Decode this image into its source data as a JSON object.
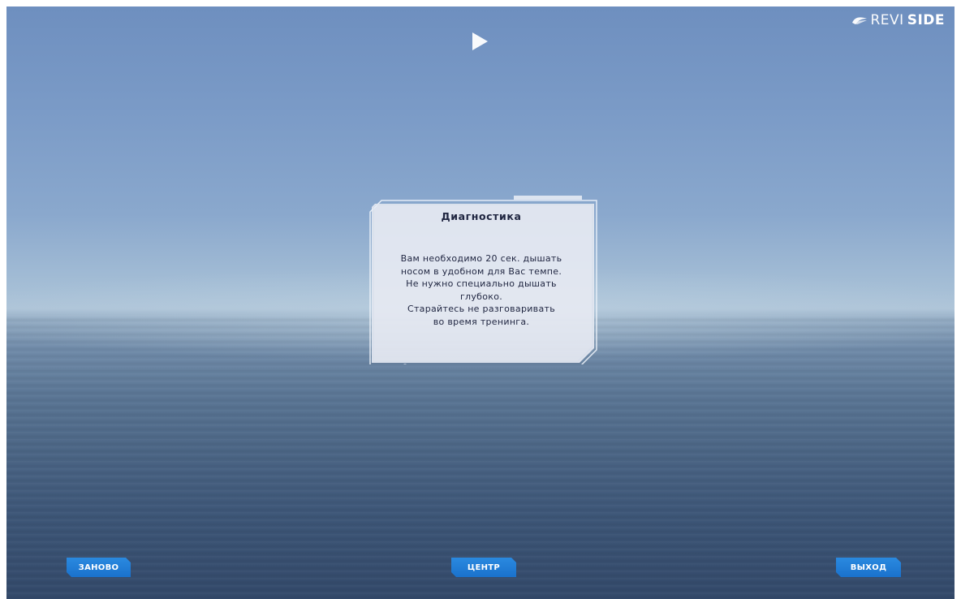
{
  "brand": {
    "logo_light": "REVI",
    "logo_bold": "SIDE"
  },
  "dialog": {
    "title": "Диагностика",
    "lines": [
      "Вам необходимо 20 сек. дышать",
      "носом в удобном для Вас темпе.",
      "Не нужно специально дышать",
      "глубоко.",
      "Старайтесь не разговаривать",
      "во время тренинга."
    ]
  },
  "controls": {
    "restart_label": "ЗАНОВО",
    "center_label": "ЦЕНТР",
    "exit_label": "ВЫХОД"
  },
  "icons": {
    "play": "play-icon",
    "logo": "wave-logo-icon"
  },
  "colors": {
    "button": "#1f7ed8",
    "panel_border": "#e8f0fa",
    "panel_fill": "#e6e9f2",
    "text_dark": "#1f2540"
  }
}
